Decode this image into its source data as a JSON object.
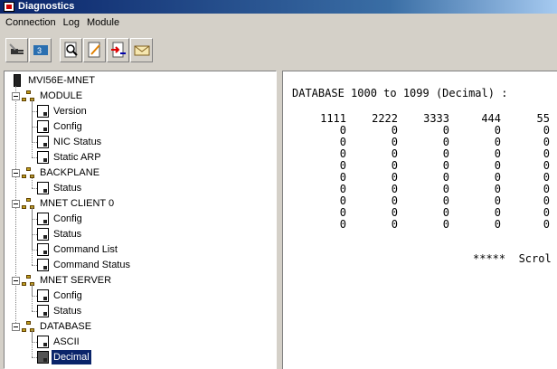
{
  "window": {
    "title": "Diagnostics"
  },
  "menu": [
    "Connection",
    "Log",
    "Module"
  ],
  "toolbar": {
    "buttons": [
      {
        "icon": "plug-connect-icon"
      },
      {
        "icon": "module-info-icon"
      },
      {
        "icon": "magnifier-search-icon"
      },
      {
        "icon": "edit-document-icon"
      },
      {
        "icon": "import-export-icon"
      },
      {
        "icon": "mail-envelope-icon"
      }
    ]
  },
  "tree": {
    "root": "MVI56E-MNET",
    "nodes": [
      {
        "label": "MODULE",
        "type": "group"
      },
      {
        "label": "Version",
        "type": "leaf"
      },
      {
        "label": "Config",
        "type": "leaf"
      },
      {
        "label": "NIC Status",
        "type": "leaf"
      },
      {
        "label": "Static ARP",
        "type": "leaf"
      },
      {
        "label": "BACKPLANE",
        "type": "group"
      },
      {
        "label": "Status",
        "type": "leaf"
      },
      {
        "label": "MNET CLIENT 0",
        "type": "group"
      },
      {
        "label": "Config",
        "type": "leaf"
      },
      {
        "label": "Status",
        "type": "leaf"
      },
      {
        "label": "Command List",
        "type": "leaf"
      },
      {
        "label": "Command Status",
        "type": "leaf"
      },
      {
        "label": "MNET SERVER",
        "type": "group"
      },
      {
        "label": "Config",
        "type": "leaf"
      },
      {
        "label": "Status",
        "type": "leaf"
      },
      {
        "label": "DATABASE",
        "type": "group"
      },
      {
        "label": "ASCII",
        "type": "leaf"
      },
      {
        "label": "Decimal",
        "type": "leaf",
        "selected": true
      }
    ]
  },
  "content": {
    "header": "DATABASE 1000 to 1099 (Decimal) :",
    "rows": [
      [
        "1111",
        "2222",
        "3333",
        "444",
        "55"
      ],
      [
        "0",
        "0",
        "0",
        "0",
        "0"
      ],
      [
        "0",
        "0",
        "0",
        "0",
        "0"
      ],
      [
        "0",
        "0",
        "0",
        "0",
        "0"
      ],
      [
        "0",
        "0",
        "0",
        "0",
        "0"
      ],
      [
        "0",
        "0",
        "0",
        "0",
        "0"
      ],
      [
        "0",
        "0",
        "0",
        "0",
        "0"
      ],
      [
        "0",
        "0",
        "0",
        "0",
        "0"
      ],
      [
        "0",
        "0",
        "0",
        "0",
        "0"
      ],
      [
        "0",
        "0",
        "0",
        "0",
        "0"
      ]
    ],
    "scroll_note": "*****  Scrol"
  },
  "colors": {
    "selection": "#0a246a",
    "titlebar": "#0a246a",
    "chrome": "#d4d0c8"
  }
}
